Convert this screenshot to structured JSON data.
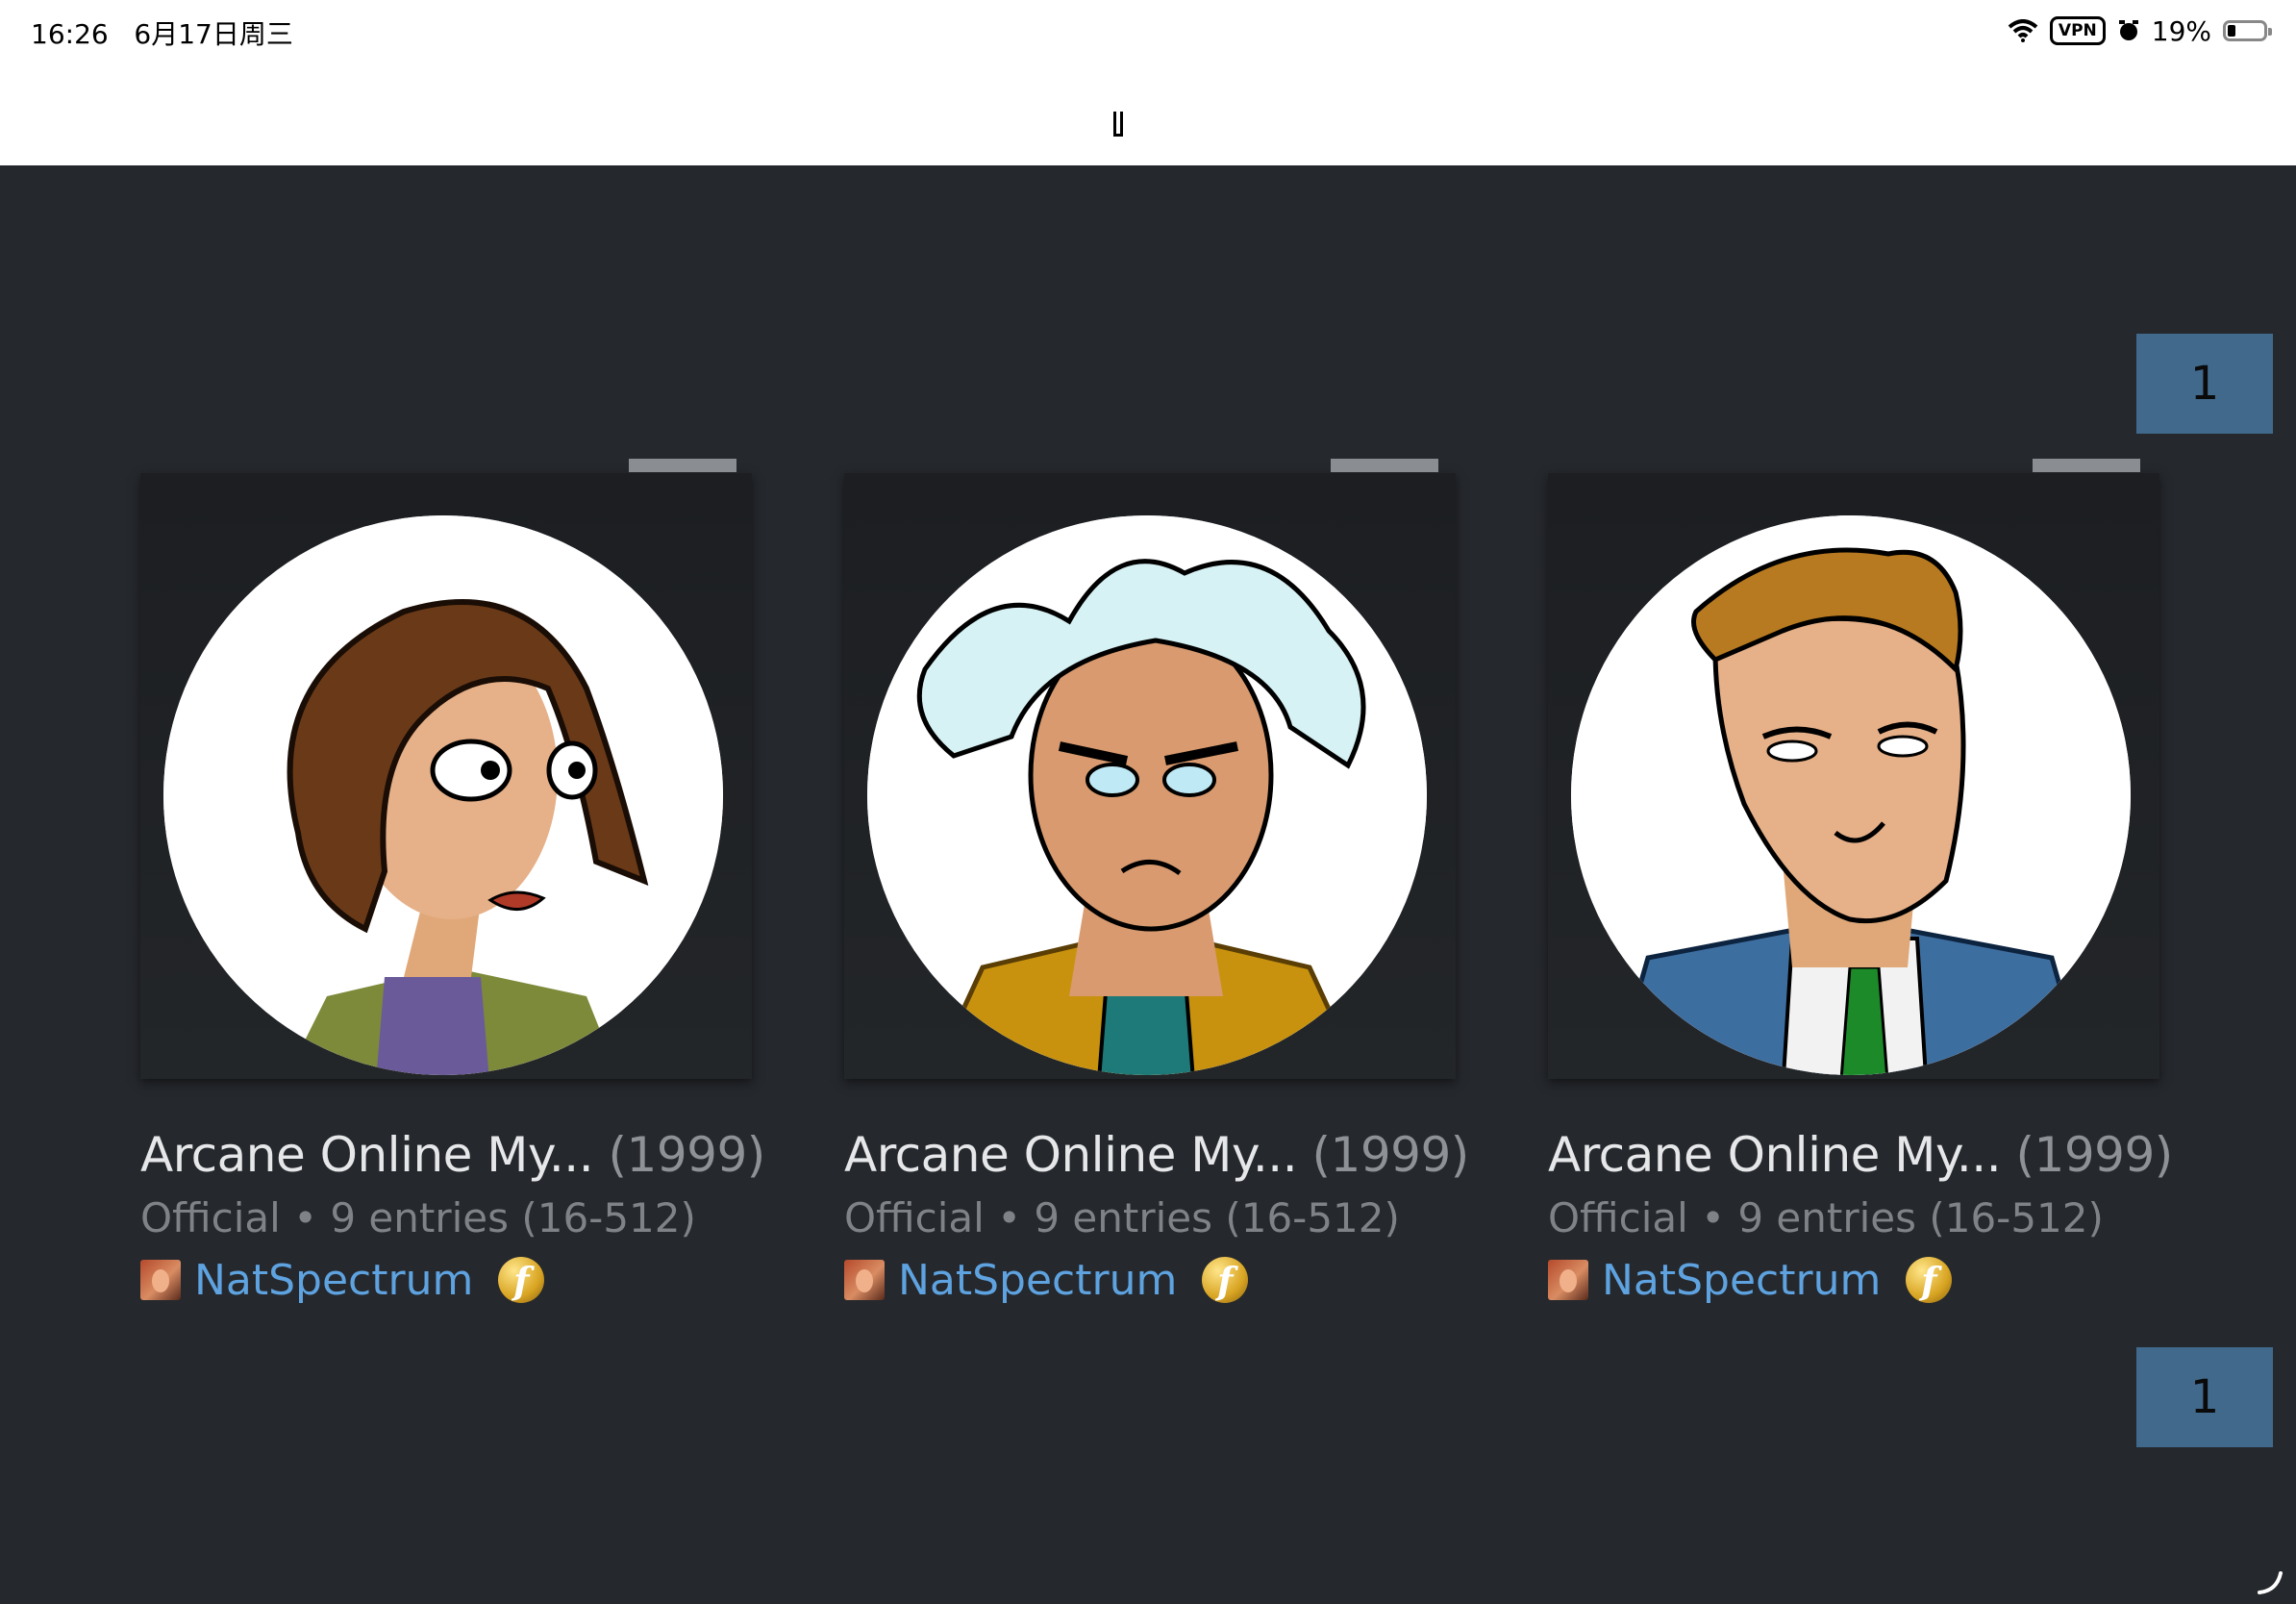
{
  "status_bar": {
    "time": "16:26   6月17日周三",
    "vpn": "VPN",
    "battery": "19%"
  },
  "pagination": {
    "top_page": "1",
    "bottom_page": "1"
  },
  "cards": [
    {
      "title": "Arcane Online My...",
      "year": "(1999)",
      "kind": "Official",
      "sep": "•",
      "entries": "9 entries (16-512)",
      "author": "NatSpectrum",
      "badge": "f",
      "portrait": "woman-brown-hair"
    },
    {
      "title": "Arcane Online My...",
      "year": "(1999)",
      "kind": "Official",
      "sep": "•",
      "entries": "9 entries (16-512)",
      "author": "NatSpectrum",
      "badge": "f",
      "portrait": "old-man-white-hair"
    },
    {
      "title": "Arcane Online My...",
      "year": "(1999)",
      "kind": "Official",
      "sep": "•",
      "entries": "9 entries (16-512)",
      "author": "NatSpectrum",
      "badge": "f",
      "portrait": "man-blonde-hair"
    }
  ],
  "colors": {
    "background": "#25282d",
    "accent": "#40698c",
    "link": "#5ea3e0"
  }
}
